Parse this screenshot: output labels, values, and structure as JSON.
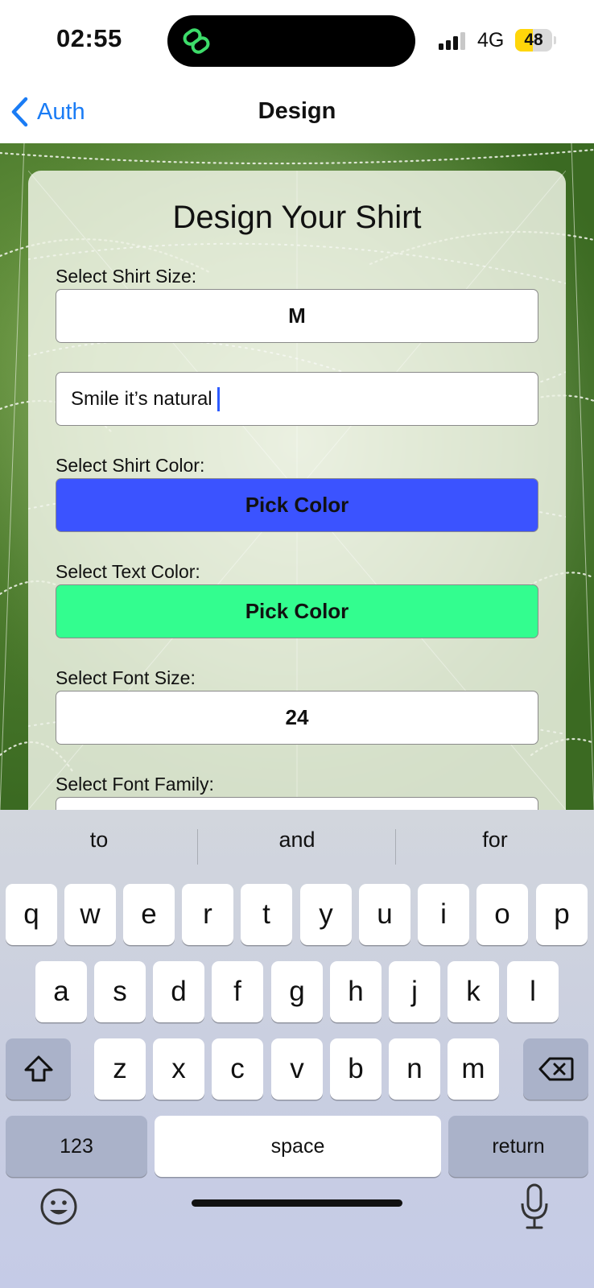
{
  "status_bar": {
    "time": "02:55",
    "network": "4G",
    "battery": "48",
    "battery_level": 0.48,
    "island_icon": "chain-link-icon"
  },
  "nav": {
    "back_label": "Auth",
    "title": "Design"
  },
  "form": {
    "heading": "Design Your Shirt",
    "size_label": "Select Shirt Size:",
    "size_value": "M",
    "text_value": "Smile it’s natural",
    "shirt_color_label": "Select Shirt Color:",
    "shirt_color_button": "Pick Color",
    "shirt_color": "#3b53ff",
    "text_color_label": "Select Text Color:",
    "text_color_button": "Pick Color",
    "text_color": "#33fd8f",
    "font_size_label": "Select Font Size:",
    "font_size_value": "24",
    "font_family_label": "Select Font Family:"
  },
  "keyboard": {
    "suggestions": [
      "to",
      "and",
      "for"
    ],
    "row1": [
      "q",
      "w",
      "e",
      "r",
      "t",
      "y",
      "u",
      "i",
      "o",
      "p"
    ],
    "row2": [
      "a",
      "s",
      "d",
      "f",
      "g",
      "h",
      "j",
      "k",
      "l"
    ],
    "row3": [
      "z",
      "x",
      "c",
      "v",
      "b",
      "n",
      "m"
    ],
    "numbers_label": "123",
    "space_label": "space",
    "return_label": "return",
    "icons": [
      "shift-icon",
      "backspace-icon",
      "emoji-icon",
      "microphone-icon"
    ]
  }
}
